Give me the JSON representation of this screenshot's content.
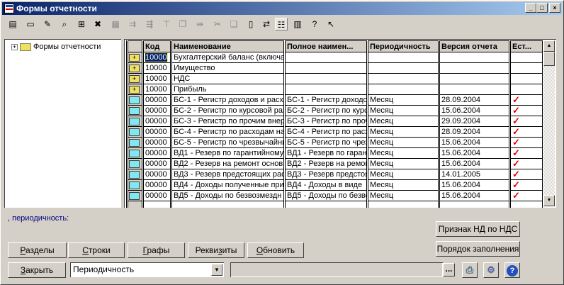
{
  "window": {
    "title": "Формы отчетности",
    "controls": [
      "_",
      "□",
      "×"
    ]
  },
  "toolbar": [
    {
      "icon": "new-icon",
      "glyph": "▤",
      "enabled": true
    },
    {
      "icon": "folder-icon",
      "glyph": "▭",
      "enabled": true
    },
    {
      "icon": "edit-icon",
      "glyph": "✎",
      "enabled": true
    },
    {
      "icon": "find-icon",
      "glyph": "⌕",
      "enabled": true
    },
    {
      "icon": "add-row-icon",
      "glyph": "⊞",
      "enabled": true
    },
    {
      "icon": "delete-icon",
      "glyph": "✖",
      "enabled": true
    },
    {
      "icon": "copy-icon",
      "glyph": "▦",
      "enabled": false
    },
    {
      "icon": "move-icon",
      "glyph": "⇉",
      "enabled": false
    },
    {
      "icon": "move-to-icon",
      "glyph": "⇶",
      "enabled": false
    },
    {
      "icon": "filter-icon",
      "glyph": "⊤",
      "enabled": false
    },
    {
      "icon": "windows-icon",
      "glyph": "❐",
      "enabled": false
    },
    {
      "icon": "forward-icon",
      "glyph": "⇛",
      "enabled": false
    },
    {
      "icon": "tools-icon",
      "glyph": "✂",
      "enabled": false
    },
    {
      "icon": "paste-icon",
      "glyph": "❏",
      "enabled": false
    },
    {
      "icon": "document-icon",
      "glyph": "▯",
      "enabled": true
    },
    {
      "icon": "export-icon",
      "glyph": "⇄",
      "enabled": true
    },
    {
      "icon": "tree-view-icon",
      "glyph": "☷",
      "enabled": true,
      "active": true
    },
    {
      "icon": "table-icon",
      "glyph": "▥",
      "enabled": true
    },
    {
      "icon": "help-icon",
      "glyph": "?",
      "enabled": true
    },
    {
      "icon": "context-help-icon",
      "glyph": "↖",
      "enabled": true
    }
  ],
  "tree": {
    "root": "Формы отчетности",
    "expander": "+"
  },
  "grid": {
    "columns": [
      "",
      "Код",
      "Наименование",
      "Полное наимен...",
      "Периодичность",
      "Версия отчета",
      "Ест..."
    ],
    "rows": [
      {
        "type": "group",
        "code": "10000",
        "name": "Бухгалтерский баланс (включа",
        "full": "",
        "period": "",
        "version": "",
        "check": false
      },
      {
        "type": "group",
        "code": "10000",
        "name": "Имущество",
        "full": "",
        "period": "",
        "version": "",
        "check": false
      },
      {
        "type": "group",
        "code": "10000",
        "name": "НДС",
        "full": "",
        "period": "",
        "version": "",
        "check": false
      },
      {
        "type": "group",
        "code": "10000",
        "name": "Прибыль",
        "full": "",
        "period": "",
        "version": "",
        "check": false
      },
      {
        "type": "item",
        "code": "00000",
        "name": "БС-1 - Регистр доходов и расхо",
        "full": "БС-1 - Регистр доходов",
        "period": "Месяц",
        "version": "28.09.2004",
        "check": true
      },
      {
        "type": "item",
        "code": "00000",
        "name": "БС-2 - Регистр по курсовой раз",
        "full": "БС-2 - Регистр по курсо",
        "period": "Месяц",
        "version": "15.06.2004",
        "check": true
      },
      {
        "type": "item",
        "code": "00000",
        "name": "БС-3 - Регистр по прочим внере",
        "full": "БС-3 - Регистр по прочим",
        "period": "Месяц",
        "version": "29.09.2004",
        "check": true
      },
      {
        "type": "item",
        "code": "00000",
        "name": "БС-4 - Регистр по расходам на",
        "full": "БС-4 - Регистр по расх",
        "period": "Месяц",
        "version": "28.09.2004",
        "check": true
      },
      {
        "type": "item",
        "code": "00000",
        "name": "БС-5 - Регистр по чрезвычайны",
        "full": "БС-5 - Регистр по чрезв",
        "period": "Месяц",
        "version": "15.06.2004",
        "check": true
      },
      {
        "type": "item",
        "code": "00000",
        "name": "ВД1 - Резерв по гарантийному",
        "full": "ВД1 - Резерв по гаран",
        "period": "Месяц",
        "version": "15.06.2004",
        "check": true
      },
      {
        "type": "item",
        "code": "00000",
        "name": "ВД2 - Резерв на ремонт основ",
        "full": "ВД2 - Резерв на ремонт",
        "period": "Месяц",
        "version": "15.06.2004",
        "check": true
      },
      {
        "type": "item",
        "code": "00000",
        "name": "ВД3 - Резерв предстоящих рас",
        "full": "ВД3 - Резерв предстоящ",
        "period": "Месяц",
        "version": "14.01.2005",
        "check": true
      },
      {
        "type": "item",
        "code": "00000",
        "name": "ВД4 - Доходы полученные при",
        "full": "ВД4 - Доходы в виде",
        "period": "Месяц",
        "version": "15.06.2004",
        "check": true
      },
      {
        "type": "item",
        "code": "00000",
        "name": "ВД5 - Доходы по безвозмездн",
        "full": "ВД5 - Доходы по безво",
        "period": "Месяц",
        "version": "15.06.2004",
        "check": true
      }
    ],
    "check_glyph": "✓"
  },
  "status_label": ", периодичность:",
  "buttons": {
    "sections": {
      "pre": "",
      "u": "Р",
      "post": "азделы"
    },
    "rows": {
      "pre": "",
      "u": "С",
      "post": "троки"
    },
    "columns": {
      "pre": "",
      "u": "Г",
      "post": "рафы"
    },
    "attributes": {
      "pre": "Рекви",
      "u": "з",
      "post": "иты"
    },
    "refresh": {
      "pre": "",
      "u": "О",
      "post": "бновить"
    },
    "close": {
      "pre": "",
      "u": "З",
      "post": "акрыть"
    },
    "vat_flag": "Признак НД по НДС",
    "fill_order": "Порядок заполнения",
    "browse": "..."
  },
  "filter_select": {
    "value": "Периодичность"
  },
  "filter_value": ""
}
